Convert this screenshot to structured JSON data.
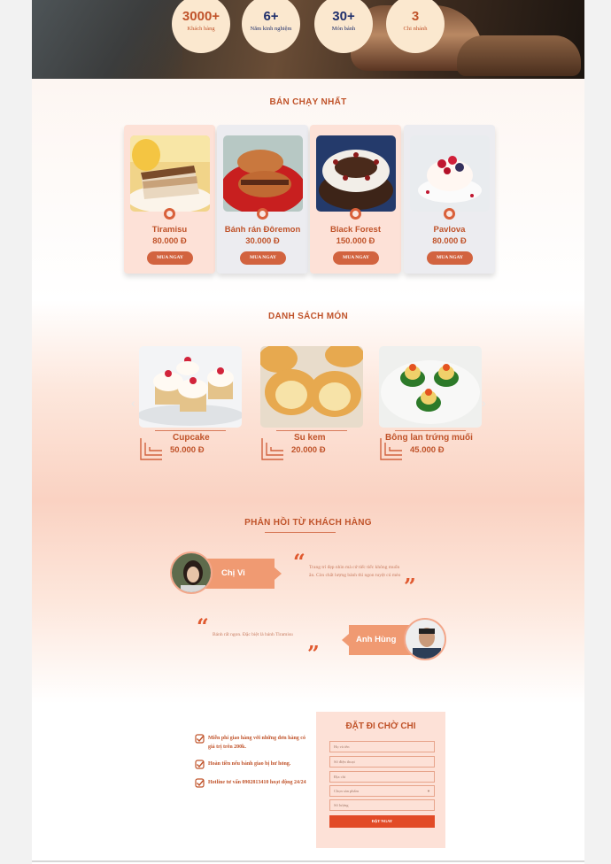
{
  "stats": [
    {
      "num": "3000+",
      "label": "Khách hàng",
      "color": "orange"
    },
    {
      "num": "6+",
      "label": "Năm kinh nghiệm",
      "color": "navy"
    },
    {
      "num": "30+",
      "label": "Món bánh",
      "color": "navy"
    },
    {
      "num": "3",
      "label": "Chi nhánh",
      "color": "orange"
    }
  ],
  "best_seller": {
    "title": "BÁN CHẠY NHẤT",
    "buy_label": "MUA NGAY",
    "items": [
      {
        "name": "Tiramisu",
        "price": "80.000 Đ"
      },
      {
        "name": "Bánh rán Đôremon",
        "price": "30.000 Đ"
      },
      {
        "name": "Black Forest",
        "price": "150.000 Đ"
      },
      {
        "name": "Pavlova",
        "price": "80.000 Đ"
      }
    ]
  },
  "dish_list": {
    "title": "DANH SÁCH MÓN",
    "items": [
      {
        "name": "Cupcake",
        "price": "50.000 Đ"
      },
      {
        "name": "Su kem",
        "price": "20.000 Đ"
      },
      {
        "name": "Bông lan trứng muối",
        "price": "45.000 Đ"
      }
    ]
  },
  "feedback": {
    "title": "PHẢN HỒI TỪ KHÁCH HÀNG",
    "items": [
      {
        "name": "Chị Vi",
        "text": "Trang trí đẹp nhìn mà cứ tiếc tiếc không muốn ăn. Còn chất lượng bánh thì ngon tuyệt cú mèo"
      },
      {
        "name": "Anh Hùng",
        "text": "Bánh rất ngon. Đặc biệt là bánh Tiramisu"
      }
    ]
  },
  "order": {
    "benefits": [
      "Miễn phí giao hàng với những đơn hàng có giá trị trên 200k.",
      "Hoàn tiền nếu bánh giao bị hư hỏng.",
      "Hotline tư vấn 0902813410 hoạt động 24/24"
    ],
    "form_title": "ĐẶT ĐI CHỜ CHI",
    "placeholders": {
      "name": "Họ và tên",
      "phone": "Số điện thoại",
      "address": "Địa chỉ",
      "product": "Chọn sản phẩm",
      "quantity": "Số lượng"
    },
    "submit_label": "ĐẶT NGAY"
  },
  "colors": {
    "accent": "#c0532a",
    "navy": "#1f2f6b",
    "card_pink": "#fde1d7",
    "button": "#e24b27"
  }
}
